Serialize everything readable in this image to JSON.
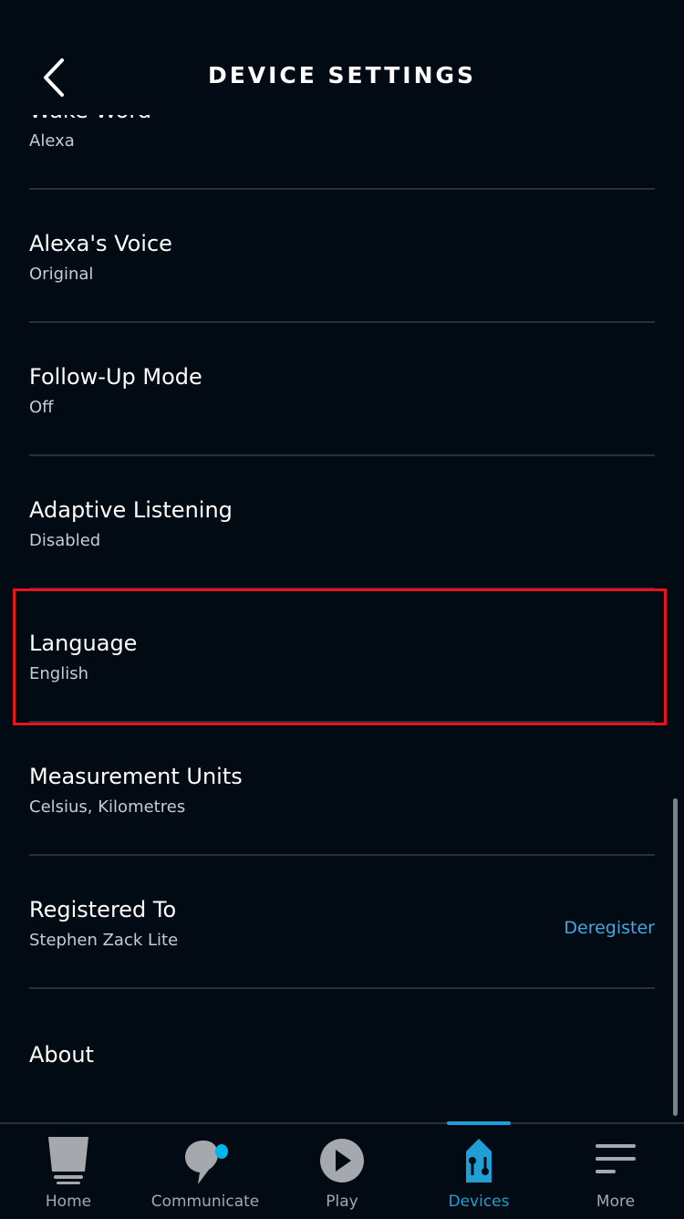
{
  "header": {
    "title": "DEVICE SETTINGS",
    "back_icon": "chevron-left-icon"
  },
  "settings": [
    {
      "title": "Wake Word",
      "value": "Alexa"
    },
    {
      "title": "Alexa's Voice",
      "value": "Original"
    },
    {
      "title": "Follow-Up Mode",
      "value": "Off"
    },
    {
      "title": "Adaptive Listening",
      "value": "Disabled"
    },
    {
      "title": "Language",
      "value": "English"
    },
    {
      "title": "Measurement Units",
      "value": "Celsius, Kilometres"
    },
    {
      "title": "Registered To",
      "value": "Stephen Zack Lite",
      "action": "Deregister"
    },
    {
      "title": "About"
    }
  ],
  "highlight_color": "#e8141a",
  "accent_color": "#1ea0d6",
  "nav": {
    "active": "Devices",
    "items": [
      {
        "label": "Home",
        "icon": "home-icon"
      },
      {
        "label": "Communicate",
        "icon": "communicate-icon"
      },
      {
        "label": "Play",
        "icon": "play-icon"
      },
      {
        "label": "Devices",
        "icon": "devices-icon"
      },
      {
        "label": "More",
        "icon": "more-icon"
      }
    ]
  }
}
